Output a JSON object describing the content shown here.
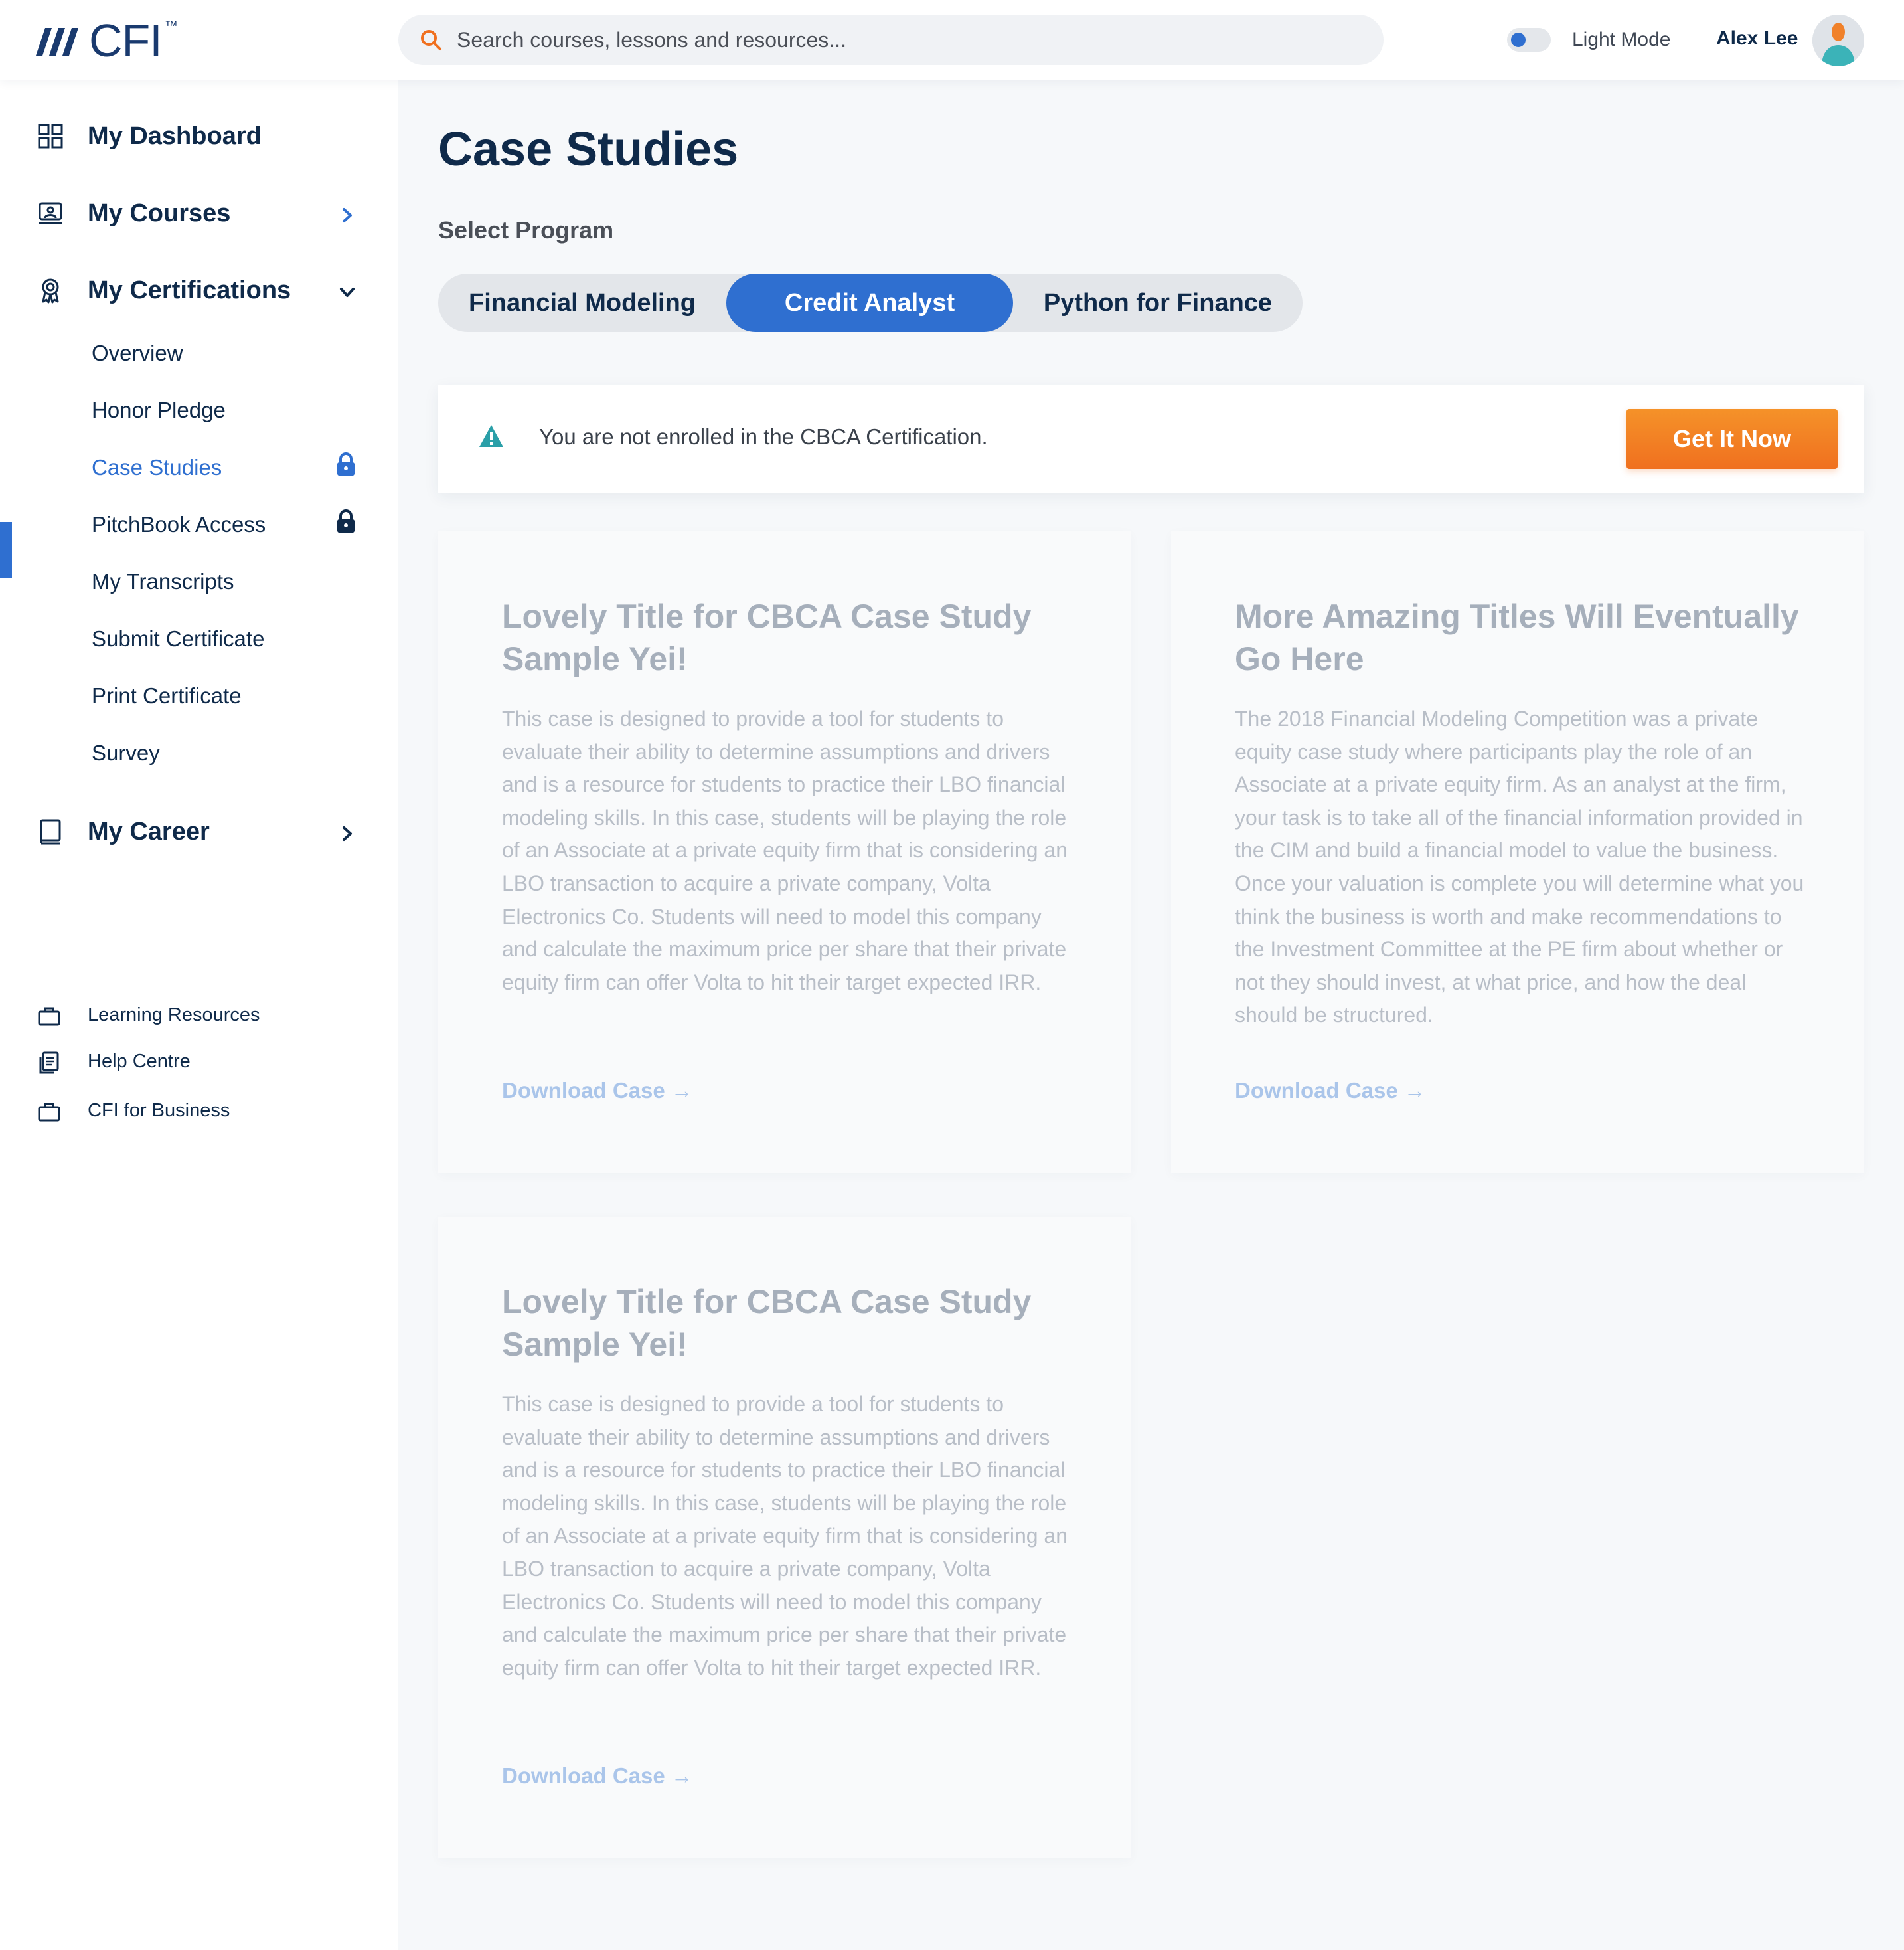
{
  "header": {
    "logo_text": "CFI",
    "logo_tm": "™",
    "search_placeholder": "Search courses, lessons and resources...",
    "mode_label": "Light Mode",
    "user_name": "Alex Lee"
  },
  "sidebar": {
    "main": [
      {
        "label": "My Dashboard",
        "icon": "dashboard-grid-icon"
      },
      {
        "label": "My Courses",
        "icon": "courses-icon"
      },
      {
        "label": "My Certifications",
        "icon": "certification-badge-icon"
      },
      {
        "label": "My Career",
        "icon": "book-icon"
      }
    ],
    "cert_items": [
      {
        "label": "Overview"
      },
      {
        "label": "Honor Pledge"
      },
      {
        "label": "Case Studies",
        "active": true,
        "locked": true
      },
      {
        "label": "PitchBook Access",
        "locked": true
      },
      {
        "label": "My Transcripts"
      },
      {
        "label": "Submit Certificate"
      },
      {
        "label": "Print Certificate"
      },
      {
        "label": "Survey"
      }
    ],
    "footer": [
      {
        "label": "Learning Resources",
        "icon": "briefcase-icon"
      },
      {
        "label": "Help Centre",
        "icon": "document-icon"
      },
      {
        "label": "CFI for Business",
        "icon": "briefcase-icon"
      }
    ]
  },
  "main": {
    "title": "Case Studies",
    "select_label": "Select Program",
    "tabs": [
      {
        "label": "Financial Modeling"
      },
      {
        "label": "Credit Analyst",
        "active": true
      },
      {
        "label": "Python for Finance"
      }
    ],
    "alert": {
      "message": "You are not enrolled in the CBCA Certification.",
      "button": "Get It Now"
    },
    "cards": [
      {
        "title": "Lovely Title for CBCA Case Study Sample Yei!",
        "description": "This case is designed to provide a tool for students to evaluate their ability to determine assumptions and drivers and is a resource for students to practice their LBO financial modeling skills. In this case, students will be playing the role of an Associate at a private equity firm that is considering an LBO transaction to acquire a private company, Volta Electronics Co. Students will need to model this company and calculate the maximum price per share that their private equity firm can offer Volta to hit their target expected IRR.",
        "link": "Download Case →"
      },
      {
        "title": "More Amazing Titles Will Eventually Go Here",
        "description": "The 2018 Financial Modeling Competition was a private equity case study where participants play the role of an Associate at a private equity firm. As an analyst at the firm, your task is to take all of the financial information provided in the CIM and build a financial model to value the business. Once your valuation is complete you will determine what you think the business is worth and make recommendations to the Investment Committee at the PE firm about whether or not they should invest, at what price, and how the deal should be structured.",
        "link": "Download Case →"
      },
      {
        "title": "Lovely Title for CBCA Case Study Sample Yei!",
        "description": "This case is designed to provide a tool for students to evaluate their ability to determine assumptions and drivers and is a resource for students to practice their LBO financial modeling skills. In this case, students will be playing the role of an Associate at a private equity firm that is considering an LBO transaction to acquire a private company, Volta Electronics Co. Students will need to model this company and calculate the maximum price per share that their private equity firm can offer Volta to hit their target expected IRR.",
        "link": "Download Case →"
      }
    ]
  },
  "colors": {
    "brand_navy": "#0f2a4a",
    "accent_blue": "#2f6fd0",
    "cta_orange": "#f0701f",
    "warning_teal": "#2a9fa8"
  }
}
